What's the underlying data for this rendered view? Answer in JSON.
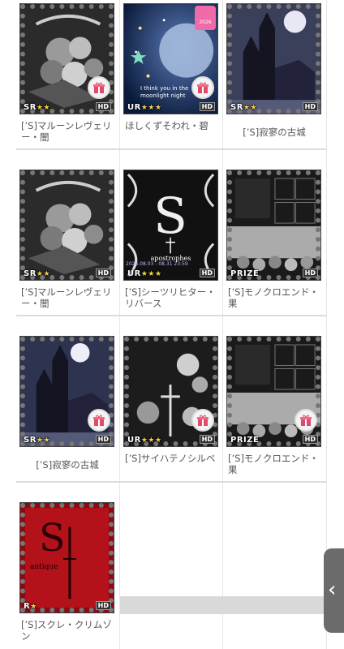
{
  "items": [
    {
      "name": "[’S]マルーンレヴェリー・闇",
      "rarity": "SR",
      "stars": "★★",
      "hd": "HD",
      "gift": true
    },
    {
      "name": "ほしくずそわれ・碧",
      "rarity": "UR",
      "stars": "★★★",
      "hd": "HD",
      "gift": true,
      "badge": "2026",
      "overlay": "I think you in the moonlight night"
    },
    {
      "name": "[’S]寂寥の古城",
      "rarity": "SR",
      "stars": "★★",
      "hd": "HD",
      "gift": false
    },
    {
      "name": "[’S]マルーンレヴェリー・闇",
      "rarity": "SR",
      "stars": "★★",
      "hd": "HD",
      "gift": false
    },
    {
      "name": "[’S]シーツリヒター・リバース",
      "rarity": "UR",
      "stars": "★★★",
      "hd": "HD",
      "gift": false,
      "date": "2026.08.03 - 08.31 23:59",
      "overlay": "apostrophes"
    },
    {
      "name": "[’S]モノクロエンド・果",
      "rarity": "PRIZE",
      "stars": "",
      "hd": "HD",
      "gift": false
    },
    {
      "name": "[’S]寂寥の古城",
      "rarity": "SR",
      "stars": "★★",
      "hd": "HD",
      "gift": true
    },
    {
      "name": "[’S]サイハテノシルベ",
      "rarity": "UR",
      "stars": "★★★",
      "hd": "HD",
      "gift": true
    },
    {
      "name": "[’S]モノクロエンド・果",
      "rarity": "PRIZE",
      "stars": "",
      "hd": "HD",
      "gift": true
    },
    {
      "name": "[’S]スクレ・クリムゾン",
      "rarity": "R",
      "stars": "★",
      "hd": "HD",
      "gift": false,
      "overlay": "antique"
    }
  ],
  "side_handle": "‹"
}
